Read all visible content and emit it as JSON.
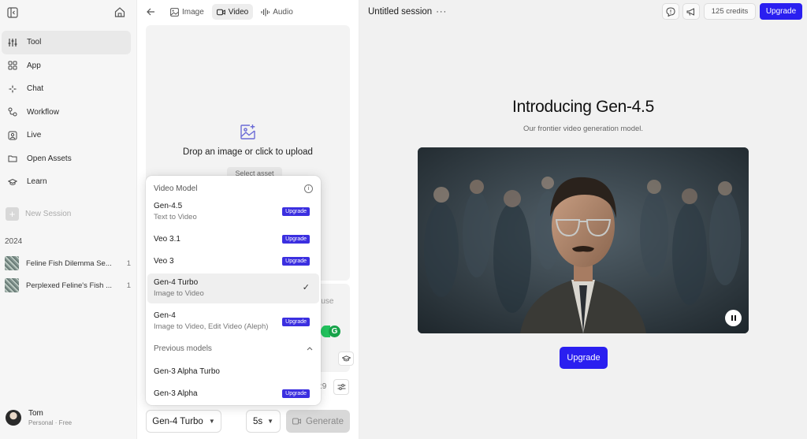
{
  "sidebar": {
    "nav": [
      {
        "label": "Tool",
        "icon": "sliders-icon"
      },
      {
        "label": "App",
        "icon": "grid-icon"
      },
      {
        "label": "Chat",
        "icon": "sparkle-icon"
      },
      {
        "label": "Workflow",
        "icon": "workflow-icon"
      },
      {
        "label": "Live",
        "icon": "live-icon"
      },
      {
        "label": "Open Assets",
        "icon": "folder-icon"
      },
      {
        "label": "Learn",
        "icon": "graduation-cap-icon"
      }
    ],
    "new_session": "New Session",
    "year": "2024",
    "history": [
      {
        "title": "Feline Fish Dilemma Se...",
        "count": "1"
      },
      {
        "title": "Perplexed Feline's Fish ...",
        "count": "1"
      }
    ],
    "user": {
      "name": "Tom",
      "plan": "Personal · Free"
    }
  },
  "panel": {
    "tabs": [
      {
        "label": "Image",
        "icon": "image-icon"
      },
      {
        "label": "Video",
        "icon": "video-camera-icon"
      },
      {
        "label": "Audio",
        "icon": "audio-wave-icon"
      }
    ],
    "upload_text": "Drop an image or click to upload",
    "select_asset": "Select asset",
    "prompt_hint": "o use",
    "ratio": ":9",
    "model_button": "Gen-4 Turbo",
    "duration": "5s",
    "generate": "Generate"
  },
  "dropdown": {
    "header": "Video Model",
    "options": [
      {
        "name": "Gen-4.5",
        "desc": "Text to Video",
        "badge": "Upgrade"
      },
      {
        "name": "Veo 3.1",
        "desc": "",
        "badge": "Upgrade"
      },
      {
        "name": "Veo 3",
        "desc": "",
        "badge": "Upgrade"
      },
      {
        "name": "Gen-4 Turbo",
        "desc": "Image to Video",
        "badge": "",
        "selected": true
      },
      {
        "name": "Gen-4",
        "desc": "Image to Video, Edit Video (Aleph)",
        "badge": "Upgrade"
      }
    ],
    "previous_label": "Previous models",
    "previous": [
      {
        "name": "Gen-3 Alpha Turbo",
        "badge": ""
      },
      {
        "name": "Gen-3 Alpha",
        "badge": "Upgrade"
      }
    ]
  },
  "main": {
    "session_title": "Untitled session",
    "credits": "125 credits",
    "upgrade_top": "Upgrade",
    "hero_title": "Introducing Gen-4.5",
    "hero_sub": "Our frontier video generation model.",
    "hero_button": "Upgrade"
  },
  "colors": {
    "accent": "#2a1ff0",
    "badge": "#3b2fe0",
    "sidebar_bg": "#f6f6f6",
    "main_bg": "#f1f1f1"
  }
}
